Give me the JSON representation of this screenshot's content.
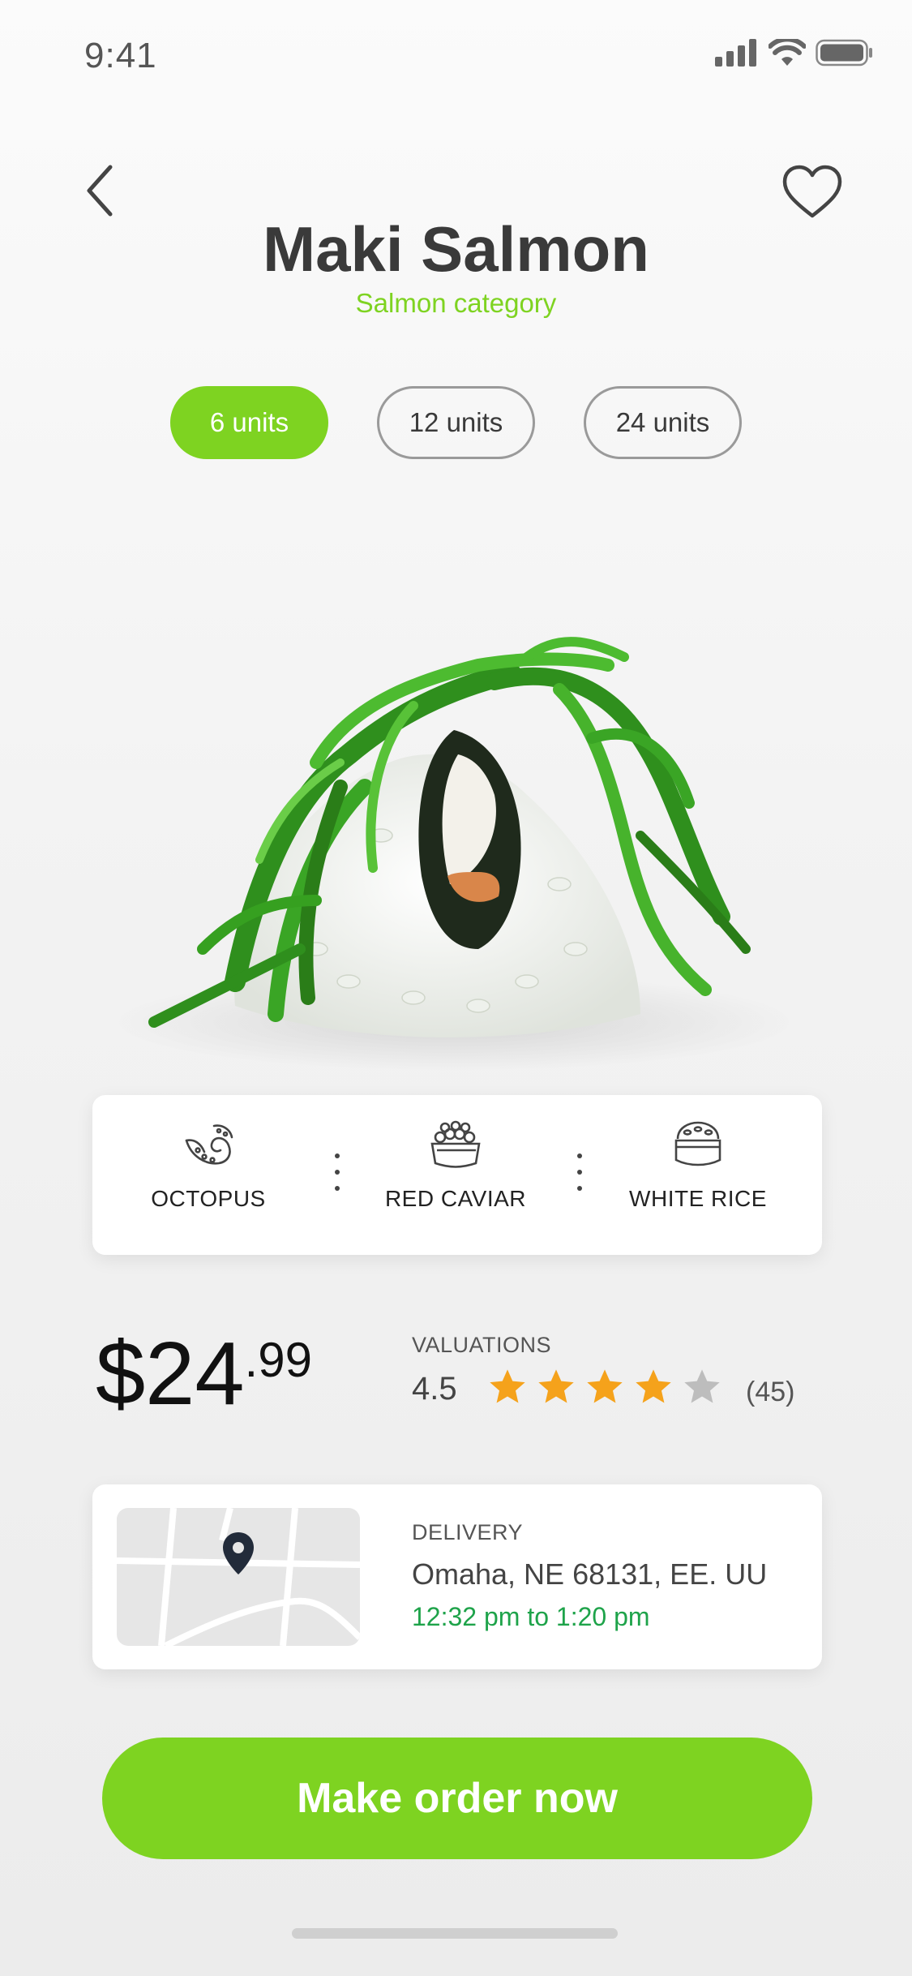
{
  "status_bar": {
    "time": "9:41"
  },
  "header": {
    "title": "Maki Salmon",
    "subtitle": "Salmon category"
  },
  "units": {
    "options": [
      "6 units",
      "12 units",
      "24 units"
    ],
    "selected": "6 units"
  },
  "ingredients": [
    {
      "label": "OCTOPUS",
      "icon": "octopus-icon"
    },
    {
      "label": "RED CAVIAR",
      "icon": "red-caviar-icon"
    },
    {
      "label": "WHITE RICE",
      "icon": "white-rice-icon"
    }
  ],
  "price": {
    "main": "$24",
    "cents": ".99"
  },
  "rating": {
    "label": "VALUATIONS",
    "value": "4.5",
    "stars_filled": 4,
    "stars_total": 5,
    "count": "(45)"
  },
  "delivery": {
    "label": "DELIVERY",
    "address": "Omaha, NE 68131, EE. UU",
    "time_window": "12:32 pm to 1:20 pm"
  },
  "cta": {
    "label": "Make order now"
  },
  "colors": {
    "accent": "#7ed321",
    "delivery_time": "#1ea34a",
    "star_filled": "#f5a21b",
    "star_empty": "#bdbdbd"
  }
}
